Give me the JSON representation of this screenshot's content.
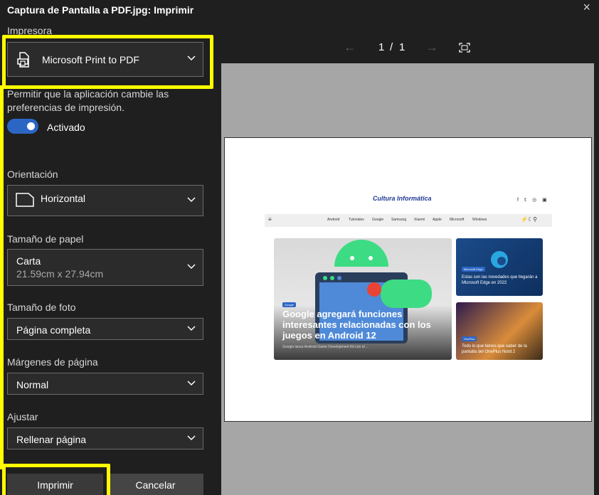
{
  "dialog": {
    "title": "Captura de Pantalla a PDF.jpg: Imprimir",
    "close_icon": "×"
  },
  "printer": {
    "label": "Impresora",
    "value": "Microsoft Print to PDF"
  },
  "permission": {
    "text_line1": "Permitir que la aplicación cambie las",
    "text_line2": "preferencias de impresión.",
    "toggle_state": "Activado"
  },
  "orientation": {
    "label": "Orientación",
    "value": "Horizontal"
  },
  "paper_size": {
    "label": "Tamaño de papel",
    "value": "Carta",
    "dimensions": "21.59cm x 27.94cm"
  },
  "photo_size": {
    "label": "Tamaño de foto",
    "value": "Página completa"
  },
  "margins": {
    "label": "Márgenes de página",
    "value": "Normal"
  },
  "fit": {
    "label": "Ajustar",
    "value": "Rellenar página"
  },
  "buttons": {
    "print": "Imprimir",
    "cancel": "Cancelar"
  },
  "preview": {
    "page_current": "1",
    "page_sep": "/",
    "page_total": "1",
    "site_logo": "Cultura Informática",
    "social_icons": "f 𝕥 ◎ ▣",
    "nav_items": [
      "Android",
      "Tutoriales",
      "Google",
      "Samsung",
      "Xiaomi",
      "Apple",
      "Microsoft",
      "Windows"
    ],
    "hero_badge": "Google",
    "hero_title": "Google agregará funciones interesantes relacionadas con los juegos en Android 12",
    "hero_subtitle": "Google lanza Android Game Development Kit con el ...",
    "card1_badge": "Microsoft Edge",
    "card1_title": "Estas son las novedades que llegarán a Microsoft Edge en 2022",
    "card2_badge": "OnePlus",
    "card2_title": "Todo lo que tienes que saber de la pantalla del OnePlus Nord 2"
  },
  "colors": {
    "highlight": "#ffff00",
    "toggle_on": "#2c66c5",
    "background": "#1f1f1f",
    "preview_bg": "#a6a6a6"
  }
}
